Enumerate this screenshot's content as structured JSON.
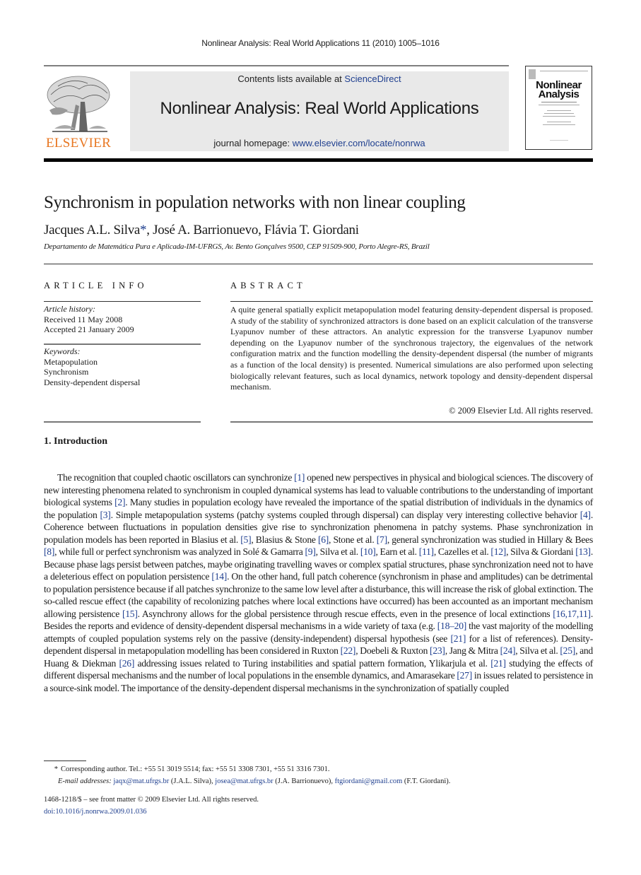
{
  "running_head": "Nonlinear Analysis: Real World Applications 11 (2010) 1005–1016",
  "masthead": {
    "publisher": "ELSEVIER",
    "contents_prefix": "Contents lists available at ",
    "contents_link": "ScienceDirect",
    "journal_title": "Nonlinear Analysis: Real World Applications",
    "homepage_prefix": "journal homepage: ",
    "homepage_link": "www.elsevier.com/locate/nonrwa",
    "cover_title_line1": "Nonlinear",
    "cover_title_line2": "Analysis"
  },
  "article": {
    "title": "Synchronism in population networks with non linear coupling",
    "authors": [
      {
        "name": "Jacques A.L. Silva",
        "mark": "*"
      },
      {
        "name": "José A. Barrionuevo"
      },
      {
        "name": "Flávia T. Giordani"
      }
    ],
    "author_sep": ", ",
    "affiliation": "Departamento de Matemática Pura e Aplicada-IM-UFRGS, Av. Bento Gonçalves 9500, CEP 91509-900, Porto Alegre-RS, Brazil"
  },
  "article_info": {
    "heading": "ARTICLE INFO",
    "history_label": "Article history:",
    "received": "Received 11 May 2008",
    "accepted": "Accepted 21 January 2009",
    "keywords_label": "Keywords:",
    "keywords": [
      "Metapopulation",
      "Synchronism",
      "Density-dependent dispersal"
    ]
  },
  "abstract": {
    "heading": "ABSTRACT",
    "text": "A quite general spatially explicit metapopulation model featuring density-dependent dispersal is proposed. A study of the stability of synchronized attractors is done based on an explicit calculation of the transverse Lyapunov number of these attractors. An analytic expression for the transverse Lyapunov number depending on the Lyapunov number of the synchronous trajectory, the eigenvalues of the network configuration matrix and the function modelling the density-dependent dispersal (the number of migrants as a function of the local density) is presented. Numerical simulations are also performed upon selecting biologically relevant features, such as local dynamics, network topology and density-dependent dispersal mechanism.",
    "copyright": "© 2009 Elsevier Ltd. All rights reserved."
  },
  "introduction": {
    "heading": "1. Introduction",
    "segments": [
      {
        "t": "The recognition that coupled chaotic oscillators can synchronize "
      },
      {
        "r": "[1]"
      },
      {
        "t": " opened new perspectives in physical and biological sciences. The discovery of new interesting phenomena related to synchronism in coupled dynamical systems has lead to valuable contributions to the understanding of important biological systems "
      },
      {
        "r": "[2]"
      },
      {
        "t": ". Many studies in population ecology have revealed the importance of the spatial distribution of individuals in the dynamics of the population "
      },
      {
        "r": "[3]"
      },
      {
        "t": ". Simple metapopulation systems (patchy systems coupled through dispersal) can display very interesting collective behavior "
      },
      {
        "r": "[4]"
      },
      {
        "t": ". Coherence between fluctuations in population densities give rise to synchronization phenomena in patchy systems. Phase synchronization in population models has been reported in Blasius et al. "
      },
      {
        "r": "[5]"
      },
      {
        "t": ", Blasius & Stone "
      },
      {
        "r": "[6]"
      },
      {
        "t": ", Stone et al. "
      },
      {
        "r": "[7]"
      },
      {
        "t": ", general synchronization was studied in Hillary & Bees "
      },
      {
        "r": "[8]"
      },
      {
        "t": ", while full or perfect synchronism was analyzed in Solé & Gamarra "
      },
      {
        "r": "[9]"
      },
      {
        "t": ", Silva et al. "
      },
      {
        "r": "[10]"
      },
      {
        "t": ", Earn et al. "
      },
      {
        "r": "[11]"
      },
      {
        "t": ", Cazelles et al. "
      },
      {
        "r": "[12]"
      },
      {
        "t": ", Silva & Giordani "
      },
      {
        "r": "[13]"
      },
      {
        "t": ". Because phase lags persist between patches, maybe originating travelling waves or complex spatial structures, phase synchronization need not to have a deleterious effect on population persistence "
      },
      {
        "r": "[14]"
      },
      {
        "t": ". On the other hand, full patch coherence (synchronism in phase and amplitudes) can be detrimental to population persistence because if all patches synchronize to the same low level after a disturbance, this will increase the risk of global extinction. The so-called rescue effect (the capability of recolonizing patches where local extinctions have occurred) has been accounted as an important mechanism allowing persistence "
      },
      {
        "r": "[15]"
      },
      {
        "t": ". Asynchrony allows for the global persistence through rescue effects, even in the presence of local extinctions "
      },
      {
        "r": "[16,17,11]"
      },
      {
        "t": ". Besides the reports and evidence of density-dependent dispersal mechanisms in a wide variety of taxa (e.g. "
      },
      {
        "r": "[18–20]"
      },
      {
        "t": " the vast majority of the modelling attempts of coupled population systems rely on the passive (density-independent) dispersal hypothesis (see "
      },
      {
        "r": "[21]"
      },
      {
        "t": " for a list of references). Density-dependent dispersal in metapopulation modelling has been considered in Ruxton "
      },
      {
        "r": "[22]"
      },
      {
        "t": ", Doebeli & Ruxton "
      },
      {
        "r": "[23]"
      },
      {
        "t": ", Jang & Mitra "
      },
      {
        "r": "[24]"
      },
      {
        "t": ", Silva et al. "
      },
      {
        "r": "[25]"
      },
      {
        "t": ", and Huang & Diekman "
      },
      {
        "r": "[26]"
      },
      {
        "t": " addressing issues related to Turing instabilities and spatial pattern formation, Ylikarjula et al. "
      },
      {
        "r": "[21]"
      },
      {
        "t": " studying the effects of different dispersal mechanisms and the number of local populations in the ensemble dynamics, and Amarasekare "
      },
      {
        "r": "[27]"
      },
      {
        "t": " in issues related to persistence in a source-sink model. The importance of the density-dependent dispersal mechanisms in the synchronization of spatially coupled"
      }
    ]
  },
  "footnote": {
    "mark": "*",
    "corresponding": "Corresponding author. Tel.: +55 51 3019 5514; fax: +55 51 3308 7301, +55 51 3316 7301.",
    "email_label": "E-mail addresses:",
    "emails": [
      {
        "address": "jaqx@mat.ufrgs.br",
        "owner": " (J.A.L. Silva), "
      },
      {
        "address": "josea@mat.ufrgs.br",
        "owner": " (J.A. Barrionuevo), "
      },
      {
        "address": "ftgiordani@gmail.com",
        "owner": " (F.T. Giordani)."
      }
    ]
  },
  "front_matter": {
    "issn_line": "1468-1218/$ – see front matter © 2009 Elsevier Ltd. All rights reserved.",
    "doi": "doi:10.1016/j.nonrwa.2009.01.036"
  },
  "colors": {
    "link": "#1f3f8f",
    "elsevier_orange": "#e87722",
    "banner_gray": "#e9e9e9"
  }
}
